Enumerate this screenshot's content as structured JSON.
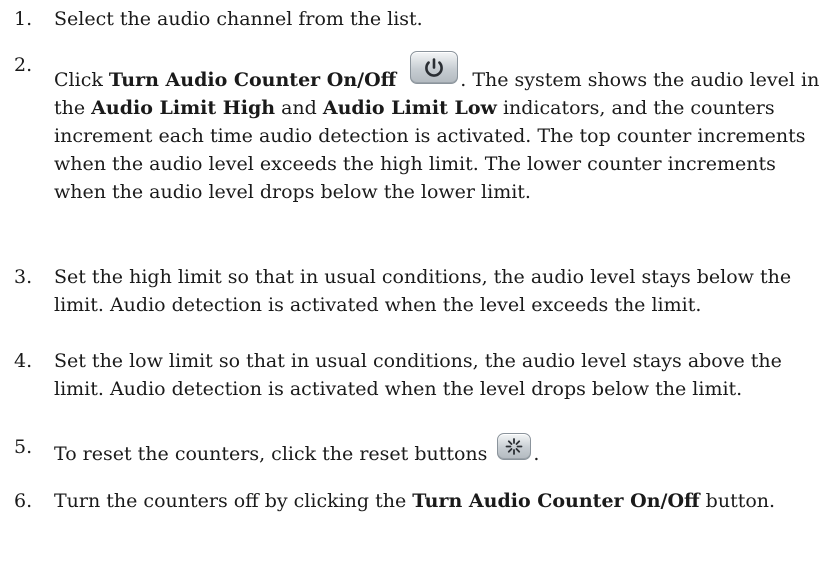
{
  "steps": [
    {
      "number": "1.",
      "text": "Select the audio channel from the list."
    },
    {
      "number": "2.",
      "prefix": "Click ",
      "bold1": "Turn Audio Counter On/Off",
      "icon": "power-icon",
      "part2": ". The system shows the audio level in the ",
      "bold2": "Audio Limit High",
      "part3": " and ",
      "bold3": "Audio Limit Low",
      "part4": " indicators, and the counters increment each time audio detection is activated. The top counter increments when the audio level exceeds the high limit. The lower counter increments when the audio level drops below the lower limit."
    },
    {
      "number": "3.",
      "text": "Set the high limit so that in usual conditions, the audio level stays below the limit. Audio detection is activated when the level exceeds the limit."
    },
    {
      "number": "4.",
      "text": "Set the low limit so that in usual conditions, the audio level stays above the limit. Audio detection is activated when the level drops below the limit."
    },
    {
      "number": "5.",
      "text": "To reset the counters, click the reset buttons",
      "icon": "reset-icon",
      "suffix": "."
    },
    {
      "number": "6.",
      "prefix": "Turn the counters off by clicking the ",
      "bold1": "Turn Audio Counter On/Off",
      "suffix": " button."
    }
  ],
  "colors": {
    "text": "#1a1a1a",
    "button_face": "#c7cdd2",
    "button_border": "#8b949c",
    "icon_stroke": "#2a2e33"
  }
}
